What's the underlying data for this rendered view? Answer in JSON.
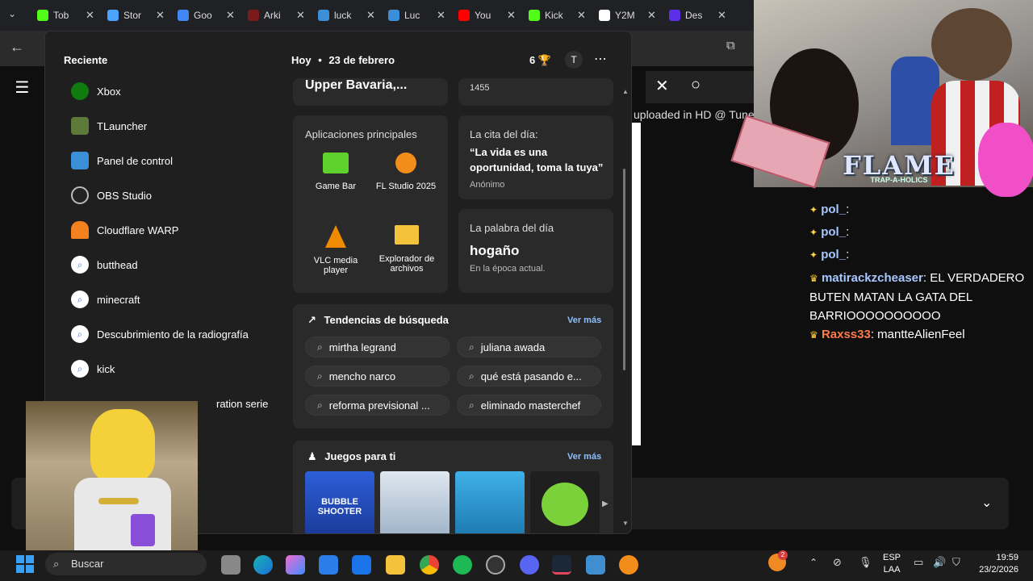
{
  "tabs": [
    {
      "title": "Tob",
      "color": "#53fc18"
    },
    {
      "title": "Stor",
      "color": "#4aa3ff"
    },
    {
      "title": "Goo",
      "color": "#4285f4"
    },
    {
      "title": "Arki",
      "color": "#7a1a1a"
    },
    {
      "title": "luck",
      "color": "#3b8fd8"
    },
    {
      "title": "Luc",
      "color": "#3b8fd8"
    },
    {
      "title": "You",
      "color": "#ff0000"
    },
    {
      "title": "Kick",
      "color": "#53fc18"
    },
    {
      "title": "Y2M",
      "color": "#ffffff"
    },
    {
      "title": "Des",
      "color": "#5b2ee8"
    }
  ],
  "page_caption": "uploaded in HD @ Tunes",
  "start_menu": {
    "recent_title": "Reciente",
    "recent": [
      {
        "label": "Xbox",
        "icon": "xbox-icon"
      },
      {
        "label": "TLauncher",
        "icon": "tlauncher-icon"
      },
      {
        "label": "Panel de control",
        "icon": "control-panel-icon"
      },
      {
        "label": "OBS Studio",
        "icon": "obs-icon"
      },
      {
        "label": "Cloudflare WARP",
        "icon": "cloudflare-icon"
      },
      {
        "label": "butthead",
        "icon": "search-icon"
      },
      {
        "label": "minecraft",
        "icon": "search-icon"
      },
      {
        "label": "Descubrimiento de la radiografía",
        "icon": "search-icon"
      },
      {
        "label": "kick",
        "icon": "search-icon"
      },
      {
        "label": "ration serie",
        "icon": "search-icon"
      }
    ],
    "today": "Hoy",
    "date": "23 de febrero",
    "points": "6",
    "avatar_letter": "T",
    "weather_location": "Upper Bavaria,...",
    "history_year": "1455",
    "top_apps": {
      "title": "Aplicaciones principales",
      "apps": [
        {
          "label": "Game Bar"
        },
        {
          "label": "FL Studio 2025"
        },
        {
          "label": "VLC media player"
        },
        {
          "label": "Explorador de archivos"
        }
      ]
    },
    "quote": {
      "title": "La cita del día:",
      "text": "“La vida es una oportunidad, toma la tuya”",
      "author": "Anónimo"
    },
    "word": {
      "title": "La palabra del día",
      "word": "hogaño",
      "meaning": "En la época actual."
    },
    "trends": {
      "title": "Tendencias de búsqueda",
      "more": "Ver más",
      "items": [
        "mirtha legrand",
        "juliana awada",
        "mencho narco",
        "qué está pasando e...",
        "reforma previsional ...",
        "eliminado masterchef"
      ]
    },
    "games": {
      "title": "Juegos para ti",
      "more": "Ver más",
      "first_label": "BUBBLE SHOOTER"
    }
  },
  "chat": [
    {
      "user": "pol_",
      "msg": ":",
      "color": "#a7c7ff"
    },
    {
      "user": "pol_",
      "msg": ":",
      "color": "#a7c7ff"
    },
    {
      "user": "pol_",
      "msg": ":",
      "color": "#a7c7ff"
    },
    {
      "user": "matirackzcheaser",
      "msg": ": EL VERDADERO BUTEN MATAN LA GATA DEL BARRIOOOOOOOOOO",
      "color": "#a7c7ff"
    },
    {
      "user": "Raxss33",
      "msg": ": mantteAlienFeel",
      "color": "#ff7b4a"
    }
  ],
  "overlay_logo": "FLAME",
  "overlay_sub": "TRAP-A-HOLICS",
  "taskbar": {
    "search_placeholder": "Buscar",
    "language": "ESP",
    "layout": "LAA",
    "time": "19:59",
    "date": "23/2/2026",
    "notification_count": "2"
  }
}
